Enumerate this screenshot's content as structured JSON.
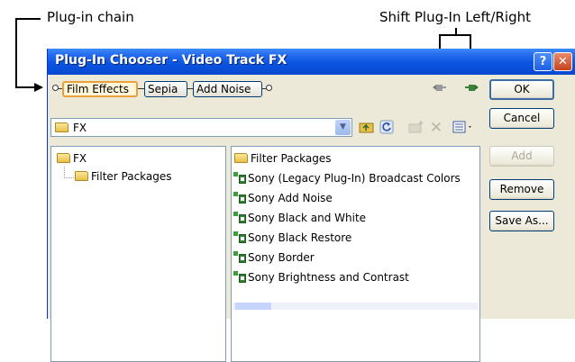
{
  "callouts": {
    "plugin_chain": "Plug-in chain",
    "shift": "Shift Plug-In Left/Right"
  },
  "window": {
    "title": "Plug-In Chooser - Video Track FX",
    "help": "?",
    "close": "✕"
  },
  "chain": {
    "items": [
      "Film Effects",
      "Sepia",
      "Add Noise"
    ],
    "active_index": 0
  },
  "buttons": {
    "ok": "OK",
    "cancel": "Cancel",
    "add": "Add",
    "remove": "Remove",
    "save_as": "Save As..."
  },
  "path": {
    "value": "FX"
  },
  "tree": {
    "root": "FX",
    "child": "Filter Packages"
  },
  "list": {
    "items": [
      {
        "label": "Filter Packages",
        "icon": "folder-icon"
      },
      {
        "label": "Sony (Legacy Plug-In) Broadcast Colors",
        "icon": "plugin-icon"
      },
      {
        "label": "Sony Add Noise",
        "icon": "plugin-icon"
      },
      {
        "label": "Sony Black and White",
        "icon": "plugin-icon"
      },
      {
        "label": "Sony Black Restore",
        "icon": "plugin-icon"
      },
      {
        "label": "Sony Border",
        "icon": "plugin-icon"
      },
      {
        "label": "Sony Brightness and Contrast",
        "icon": "plugin-icon"
      }
    ]
  },
  "colors": {
    "titlebar": "#0a55e0",
    "active_chain_border": "#e8a03a"
  }
}
